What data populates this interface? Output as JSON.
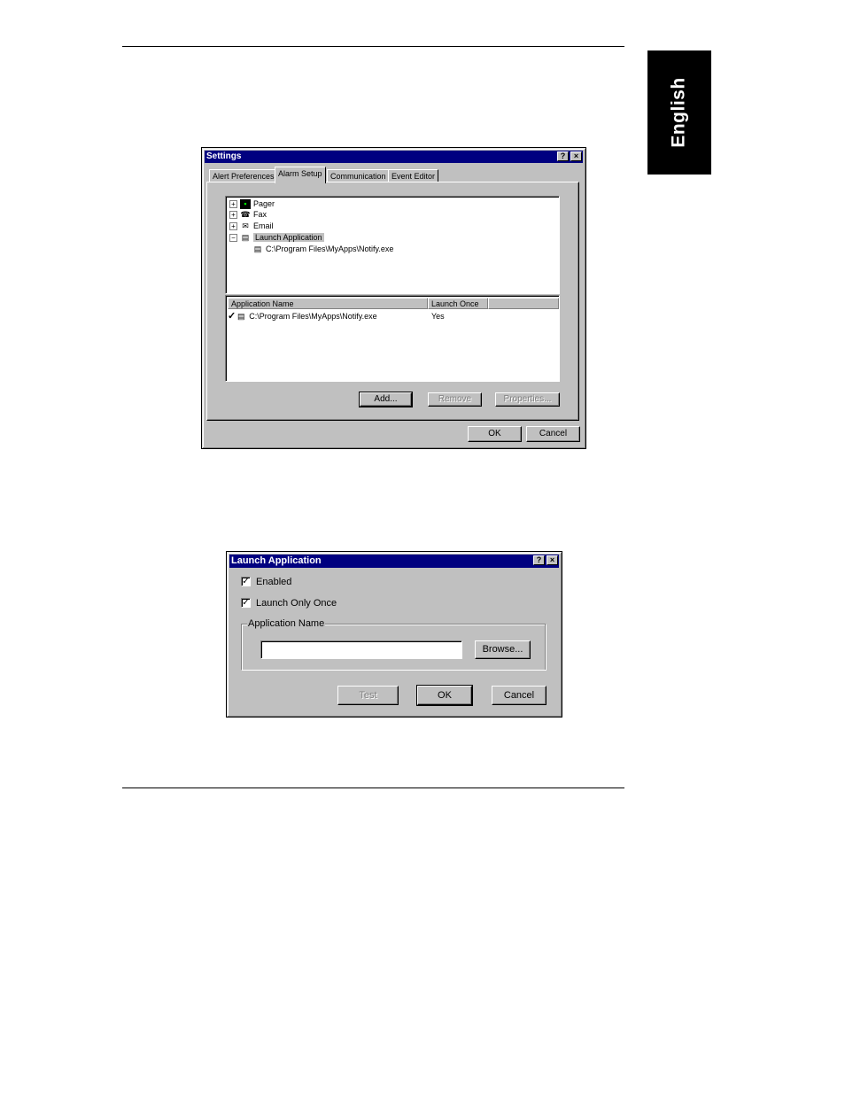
{
  "side_tab": {
    "label": "English"
  },
  "settings": {
    "title": "Settings",
    "help_label": "?",
    "close_label": "×",
    "tabs": [
      "Alert Preferences",
      "Alarm Setup",
      "Communication",
      "Event Editor"
    ],
    "tree": {
      "items": [
        {
          "label": "Pager",
          "icon": "pager-icon"
        },
        {
          "label": "Fax",
          "icon": "fax-icon"
        },
        {
          "label": "Email",
          "icon": "email-icon"
        },
        {
          "label": "Launch Application",
          "icon": "launch-app-icon"
        }
      ],
      "child": {
        "label": "C:\\Program Files\\MyApps\\Notify.exe",
        "icon": "exe-file-icon"
      }
    },
    "list": {
      "columns": [
        "Application Name",
        "Launch Once"
      ],
      "rows": [
        {
          "name": "C:\\Program Files\\MyApps\\Notify.exe",
          "once": "Yes",
          "checked": "✓"
        }
      ]
    },
    "buttons": {
      "add": "Add...",
      "remove": "Remove",
      "properties": "Properties...",
      "ok": "OK",
      "cancel": "Cancel"
    }
  },
  "launch_dialog": {
    "title": "Launch Application",
    "help_label": "?",
    "close_label": "×",
    "enabled_label": "Enabled",
    "enabled_checked": "✓",
    "once_label": "Launch Only Once",
    "once_checked": "✓",
    "group_label": "Application Name",
    "app_name_value": "",
    "buttons": {
      "browse": "Browse...",
      "test": "Test",
      "ok": "OK",
      "cancel": "Cancel"
    }
  }
}
